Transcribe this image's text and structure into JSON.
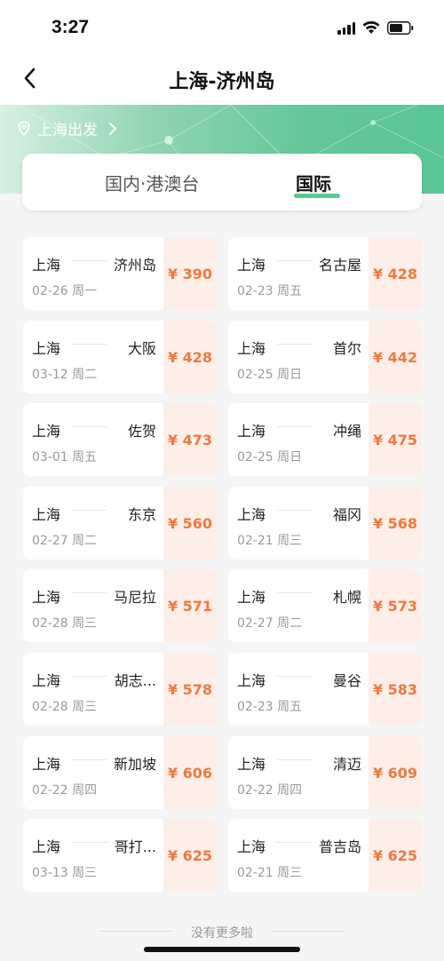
{
  "status_bar": {
    "time": "3:27"
  },
  "header": {
    "title": "上海-济州岛",
    "back_icon": "chevron-left-icon"
  },
  "banner": {
    "departure_label": "上海出发",
    "location_icon": "location-pin-icon",
    "chevron_icon": "chevron-right-icon"
  },
  "tabs": [
    {
      "label": "国内·港澳台",
      "selected": false
    },
    {
      "label": "国际",
      "selected": true
    }
  ],
  "colors": {
    "accent_green": "#3fbe7c",
    "price_orange": "#ee7940",
    "price_bg": "#fdeee8"
  },
  "routes": [
    {
      "from": "上海",
      "to": "济州岛",
      "date": "02-26 周一",
      "price": "¥ 390"
    },
    {
      "from": "上海",
      "to": "名古屋",
      "date": "02-23 周五",
      "price": "¥ 428"
    },
    {
      "from": "上海",
      "to": "大阪",
      "date": "03-12 周二",
      "price": "¥ 428"
    },
    {
      "from": "上海",
      "to": "首尔",
      "date": "02-25 周日",
      "price": "¥ 442"
    },
    {
      "from": "上海",
      "to": "佐贺",
      "date": "03-01 周五",
      "price": "¥ 473"
    },
    {
      "from": "上海",
      "to": "冲绳",
      "date": "02-25 周日",
      "price": "¥ 475"
    },
    {
      "from": "上海",
      "to": "东京",
      "date": "02-27 周二",
      "price": "¥ 560"
    },
    {
      "from": "上海",
      "to": "福冈",
      "date": "02-21 周三",
      "price": "¥ 568"
    },
    {
      "from": "上海",
      "to": "马尼拉",
      "date": "02-28 周三",
      "price": "¥ 571"
    },
    {
      "from": "上海",
      "to": "札幌",
      "date": "02-27 周二",
      "price": "¥ 573"
    },
    {
      "from": "上海",
      "to": "胡志...",
      "date": "02-28 周三",
      "price": "¥ 578"
    },
    {
      "from": "上海",
      "to": "曼谷",
      "date": "02-23 周五",
      "price": "¥ 583"
    },
    {
      "from": "上海",
      "to": "新加坡",
      "date": "02-22 周四",
      "price": "¥ 606"
    },
    {
      "from": "上海",
      "to": "清迈",
      "date": "02-22 周四",
      "price": "¥ 609"
    },
    {
      "from": "上海",
      "to": "哥打...",
      "date": "03-13 周三",
      "price": "¥ 625"
    },
    {
      "from": "上海",
      "to": "普吉岛",
      "date": "02-21 周三",
      "price": "¥ 625"
    }
  ],
  "footer": {
    "text": "没有更多啦"
  }
}
